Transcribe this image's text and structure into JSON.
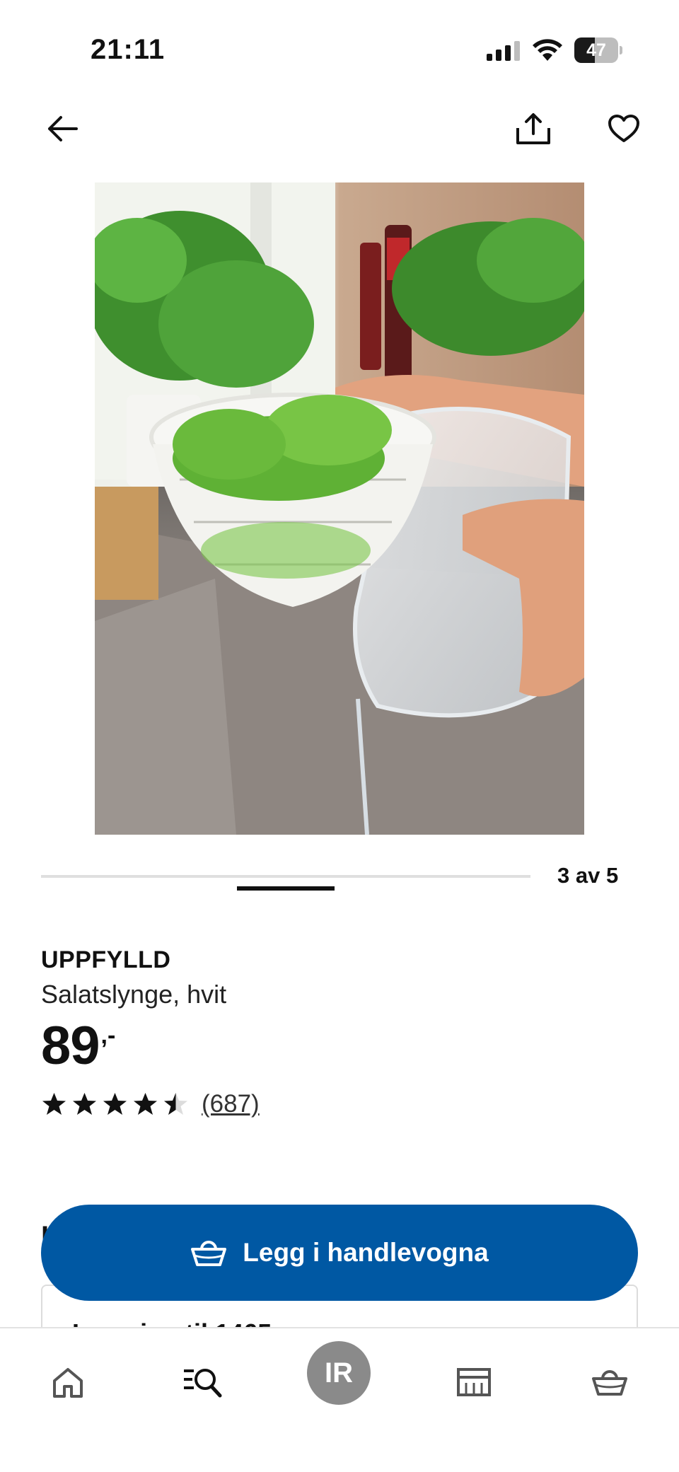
{
  "status_bar": {
    "time": "21:11",
    "battery_level": "47",
    "battery_fraction": 0.47
  },
  "top_nav": {
    "back_icon": "arrow-left-icon",
    "share_icon": "share-icon",
    "favorite_icon": "heart-icon"
  },
  "carousel": {
    "current": 3,
    "total": 5,
    "counter_text": "3 av 5"
  },
  "product": {
    "name": "UPPFYLLD",
    "description": "Salatslynge, hvit",
    "price_whole": "89",
    "price_suffix": ",-",
    "rating": 4.5,
    "rating_max": 5,
    "review_count": "(687)"
  },
  "section": {
    "peek_letter": "L"
  },
  "delivery": {
    "text": "Levering til 1465"
  },
  "cart_button": {
    "label": "Legg i handlevogna",
    "icon": "basket-icon",
    "color": "#0058a3"
  },
  "bottom_nav": {
    "items": [
      {
        "name": "home",
        "icon": "home-icon"
      },
      {
        "name": "search",
        "icon": "search-list-icon"
      },
      {
        "name": "profile",
        "initials": "IR"
      },
      {
        "name": "store",
        "icon": "store-icon"
      },
      {
        "name": "cart",
        "icon": "basket-icon"
      }
    ]
  }
}
